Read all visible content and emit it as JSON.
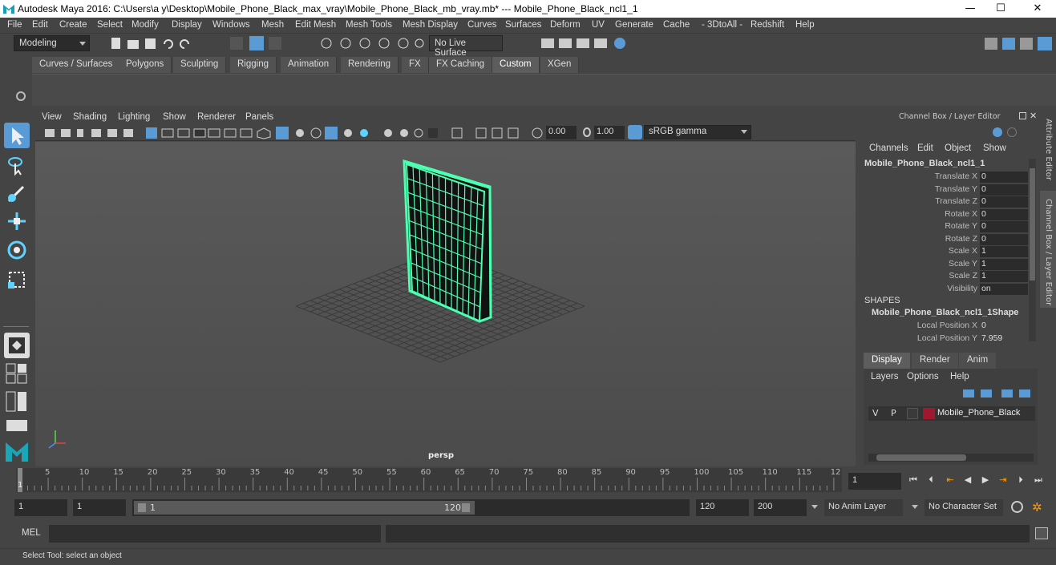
{
  "title_bar": {
    "title": "Autodesk Maya 2016: C:\\Users\\a y\\Desktop\\Mobile_Phone_Black_max_vray\\Mobile_Phone_Black_mb_vray.mb*   ---   Mobile_Phone_Black_ncl1_1",
    "minimize": "—",
    "maximize": "☐",
    "close": "✕"
  },
  "menubar": {
    "items": [
      "File",
      "Edit",
      "Create",
      "Select",
      "Modify",
      "Display",
      "Windows",
      "Mesh",
      "Edit Mesh",
      "Mesh Tools",
      "Mesh Display",
      "Curves",
      "Surfaces",
      "Deform",
      "UV",
      "Generate",
      "Cache",
      "- 3DtoAll -",
      "Redshift",
      "Help"
    ]
  },
  "status_line": {
    "mode": "Modeling",
    "live_surface": "No Live Surface"
  },
  "shelf": {
    "tabs": [
      "Curves / Surfaces",
      "Polygons",
      "Sculpting",
      "Rigging",
      "Animation",
      "Rendering",
      "FX",
      "FX Caching",
      "Custom",
      "XGen"
    ],
    "active_tab": "Custom"
  },
  "viewport": {
    "menu": [
      "View",
      "Shading",
      "Lighting",
      "Show",
      "Renderer",
      "Panels"
    ],
    "exposure": "0.00",
    "gamma": "1.00",
    "color_space": "sRGB gamma",
    "camera_label": "persp"
  },
  "channel_box": {
    "header": "Channel Box / Layer Editor",
    "menu": [
      "Channels",
      "Edit",
      "Object",
      "Show"
    ],
    "object_name": "Mobile_Phone_Black_ncl1_1",
    "channels": [
      {
        "label": "Translate X",
        "value": "0"
      },
      {
        "label": "Translate Y",
        "value": "0"
      },
      {
        "label": "Translate Z",
        "value": "0"
      },
      {
        "label": "Rotate X",
        "value": "0"
      },
      {
        "label": "Rotate Y",
        "value": "0"
      },
      {
        "label": "Rotate Z",
        "value": "0"
      },
      {
        "label": "Scale X",
        "value": "1"
      },
      {
        "label": "Scale Y",
        "value": "1"
      },
      {
        "label": "Scale Z",
        "value": "1"
      },
      {
        "label": "Visibility",
        "value": "on"
      }
    ],
    "shapes_label": "SHAPES",
    "shape_name": "Mobile_Phone_Black_ncl1_1Shape",
    "shape_channels": [
      {
        "label": "Local Position X",
        "value": "0"
      },
      {
        "label": "Local Position Y",
        "value": "7.959"
      }
    ]
  },
  "layer_editor": {
    "tabs": [
      "Display",
      "Render",
      "Anim"
    ],
    "active_tab": "Display",
    "menu": [
      "Layers",
      "Options",
      "Help"
    ],
    "layer": {
      "v": "V",
      "p": "P",
      "name": "Mobile_Phone_Black",
      "color": "#a0182e"
    }
  },
  "side_tabs": [
    "Attribute Editor",
    "Channel Box / Layer Editor"
  ],
  "timeline": {
    "ticks": [
      "5",
      "10",
      "15",
      "20",
      "25",
      "30",
      "35",
      "40",
      "45",
      "50",
      "55",
      "60",
      "65",
      "70",
      "75",
      "80",
      "85",
      "90",
      "95",
      "100",
      "105",
      "110",
      "115",
      "12"
    ],
    "start_marker": "1",
    "current_frame": "1"
  },
  "range": {
    "start": "1",
    "playback_start": "1",
    "slider_start": "1",
    "slider_end": "120",
    "playback_end": "120",
    "end": "200",
    "anim_layer": "No Anim Layer",
    "character_set": "No Character Set"
  },
  "mel": {
    "label": "MEL"
  },
  "help_line": {
    "text": "Select Tool: select an object"
  },
  "colors": {
    "accent": "#5a9bd5",
    "wireframe": "#4dffb0",
    "layer_color": "#a0182e"
  }
}
